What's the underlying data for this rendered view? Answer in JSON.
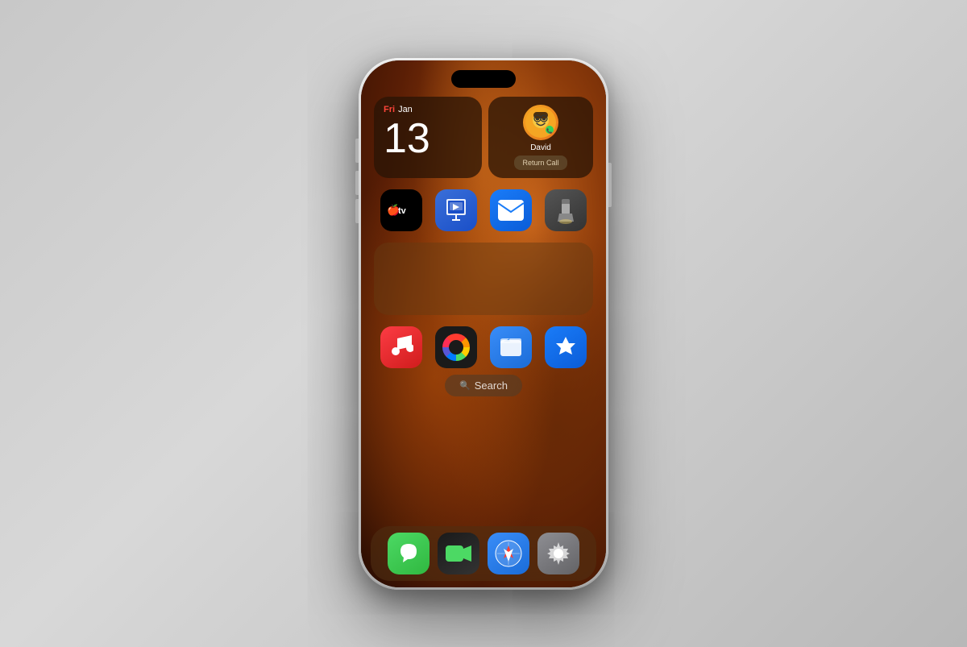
{
  "phone": {
    "background": "desert wallpaper warm tones"
  },
  "widgets": {
    "calendar": {
      "day": "Fri",
      "month": "Jan",
      "date": "13"
    },
    "contact": {
      "name": "David",
      "action": "Return Call"
    }
  },
  "app_row_1": [
    {
      "id": "apple-tv",
      "label": "Apple TV"
    },
    {
      "id": "keynote",
      "label": "Keynote"
    },
    {
      "id": "mail",
      "label": "Mail"
    },
    {
      "id": "flashlight",
      "label": "Flashlight"
    }
  ],
  "app_row_2": [
    {
      "id": "music",
      "label": "Music"
    },
    {
      "id": "photos",
      "label": "Photos"
    },
    {
      "id": "files",
      "label": "Files"
    },
    {
      "id": "appstore",
      "label": "App Store"
    }
  ],
  "search": {
    "label": "Search"
  },
  "dock": [
    {
      "id": "messages",
      "label": "Messages"
    },
    {
      "id": "facetime",
      "label": "FaceTime"
    },
    {
      "id": "safari",
      "label": "Safari"
    },
    {
      "id": "settings",
      "label": "Settings"
    }
  ]
}
